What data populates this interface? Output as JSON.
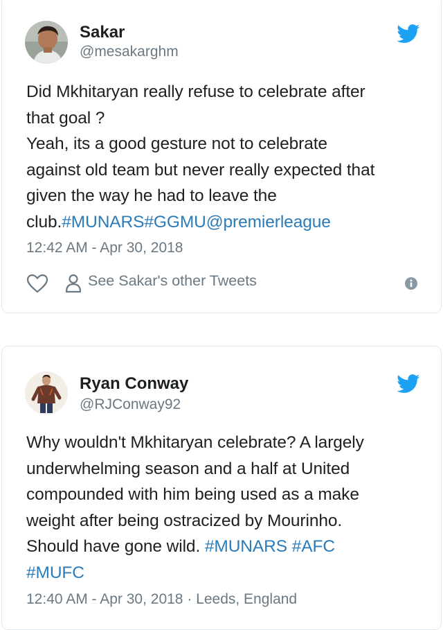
{
  "tweets": [
    {
      "name": "Sakar",
      "handle": "@mesakarghm",
      "text_lines": [
        [
          {
            "t": "Did Mkhitaryan really refuse to celebrate after",
            "link": false
          }
        ],
        [
          {
            "t": "that goal ?",
            "link": false
          }
        ],
        [
          {
            "t": "Yeah, its a good gesture not to celebrate",
            "link": false
          }
        ],
        [
          {
            "t": "against old team but never really expected that",
            "link": false
          }
        ],
        [
          {
            "t": "given the way he had to leave the",
            "link": false
          }
        ],
        [
          {
            "t": "club.",
            "link": false
          },
          {
            "t": "#MUNARS",
            "link": true
          },
          {
            "t": "#GGMU",
            "link": true
          },
          {
            "t": "@premierleague",
            "link": true
          }
        ]
      ],
      "timestamp": "12:42 AM - Apr 30, 2018",
      "other_tweets_label": "See Sakar's other Tweets"
    },
    {
      "name": "Ryan Conway",
      "handle": "@RJConway92",
      "text_lines": [
        [
          {
            "t": "Why wouldn't Mkhitaryan celebrate? A largely",
            "link": false
          }
        ],
        [
          {
            "t": "underwhelming season and a half at United",
            "link": false
          }
        ],
        [
          {
            "t": "compounded with him being used as a make",
            "link": false
          }
        ],
        [
          {
            "t": "weight after being ostracized by Mourinho.",
            "link": false
          }
        ],
        [
          {
            "t": "Should have gone wild. ",
            "link": false
          },
          {
            "t": "#MUNARS",
            "link": true
          },
          {
            "t": " ",
            "link": false
          },
          {
            "t": "#AFC",
            "link": true
          }
        ],
        [
          {
            "t": "#MUFC",
            "link": true
          }
        ]
      ],
      "timestamp": "12:40 AM - Apr 30, 2018 · Leeds, England"
    }
  ],
  "icons": {
    "twitter_bird": "twitter-bird-icon",
    "like": "heart-icon",
    "profile": "person-icon",
    "info": "info-icon"
  },
  "colors": {
    "link": "#2b7bb9",
    "bird": "#1da1f2",
    "muted": "#697882",
    "text": "#1c2022"
  }
}
